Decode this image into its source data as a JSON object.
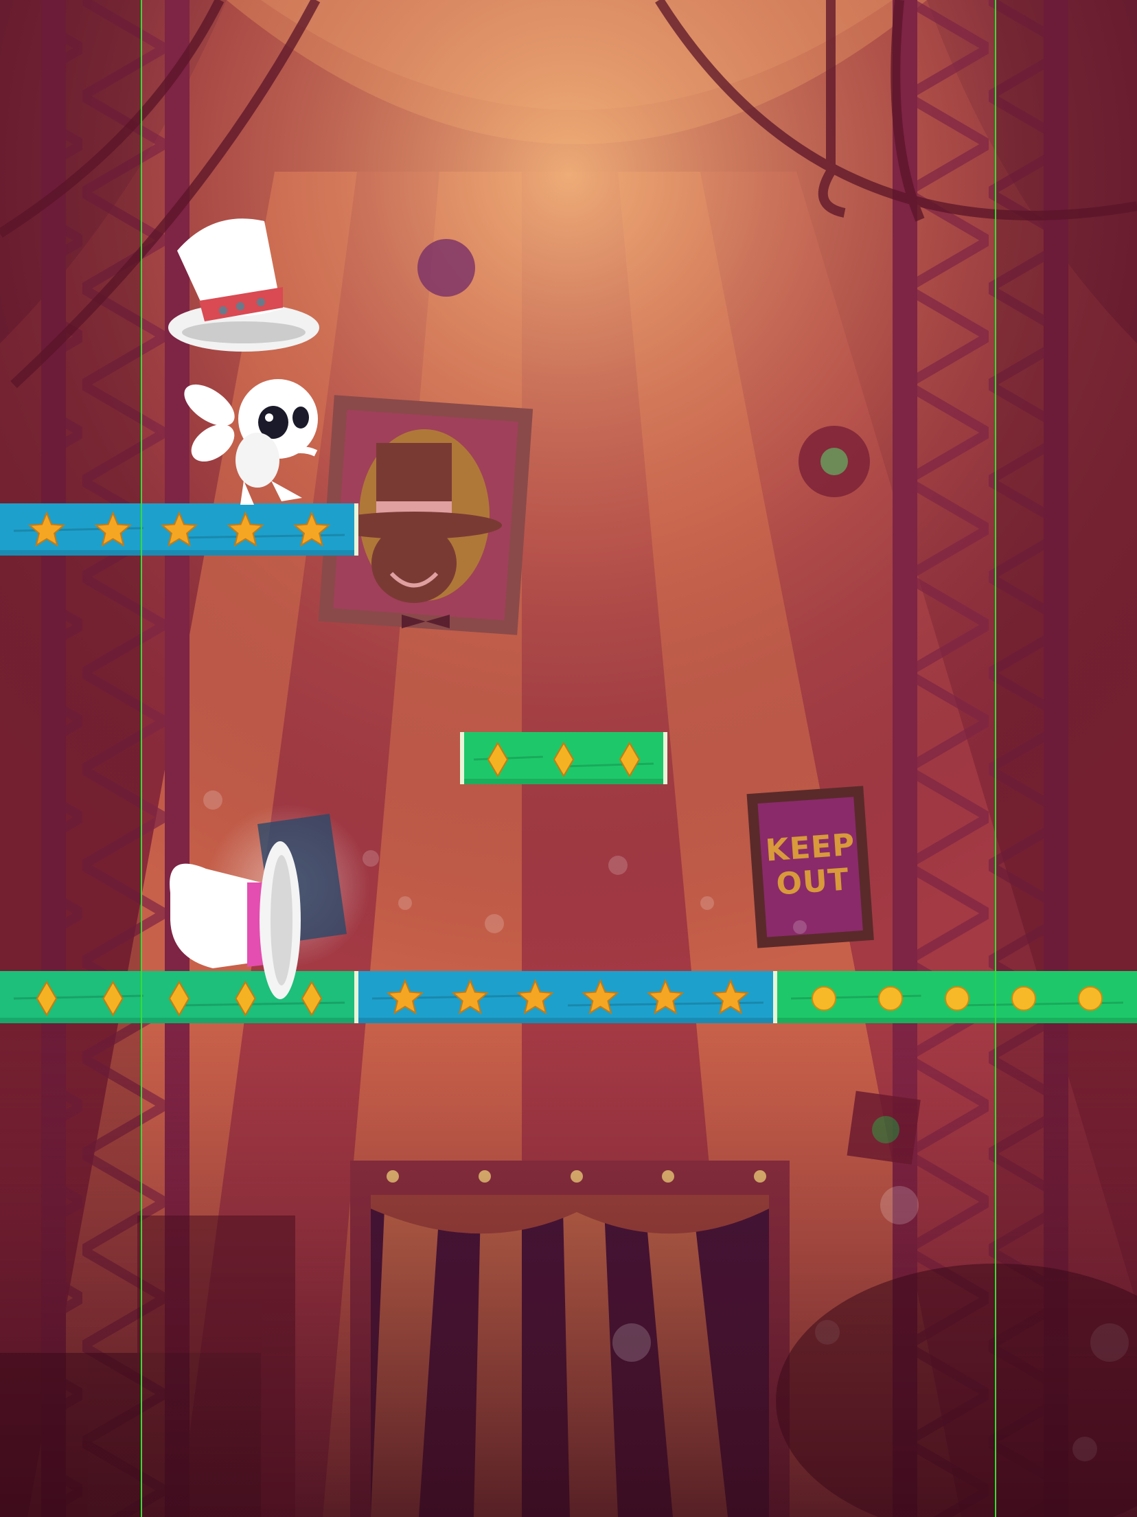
{
  "sign": {
    "line1": "KEEP",
    "line2": "OUT"
  },
  "platforms": [
    {
      "id": "top-left-blue",
      "type": "blue",
      "collectible": "star",
      "count": 5
    },
    {
      "id": "middle-green",
      "type": "green",
      "collectible": "diamond",
      "count": 3
    },
    {
      "id": "bottom-left-green",
      "type": "teal",
      "collectible": "diamond",
      "count": 5
    },
    {
      "id": "bottom-middle-blue",
      "type": "blue",
      "collectible": "star",
      "count": 6
    },
    {
      "id": "bottom-right-green",
      "type": "green",
      "collectible": "coin",
      "count": 5
    }
  ],
  "colors": {
    "background": "#8a2a3a",
    "curtain_light": "#c76a4a",
    "curtain_dark": "#7a1e36",
    "blue_platform": "#1ea0cc",
    "green_platform": "#1ec86a",
    "teal_platform": "#1dbf7a",
    "star": "#f5a623",
    "diamond": "#f5b323",
    "coin": "#f7b928",
    "guide_line": "#33dd33"
  },
  "characters": {
    "player": "rabbit-character",
    "hat_above": "top-hat-icon",
    "hat_goal": "tipped-top-hat-icon"
  }
}
